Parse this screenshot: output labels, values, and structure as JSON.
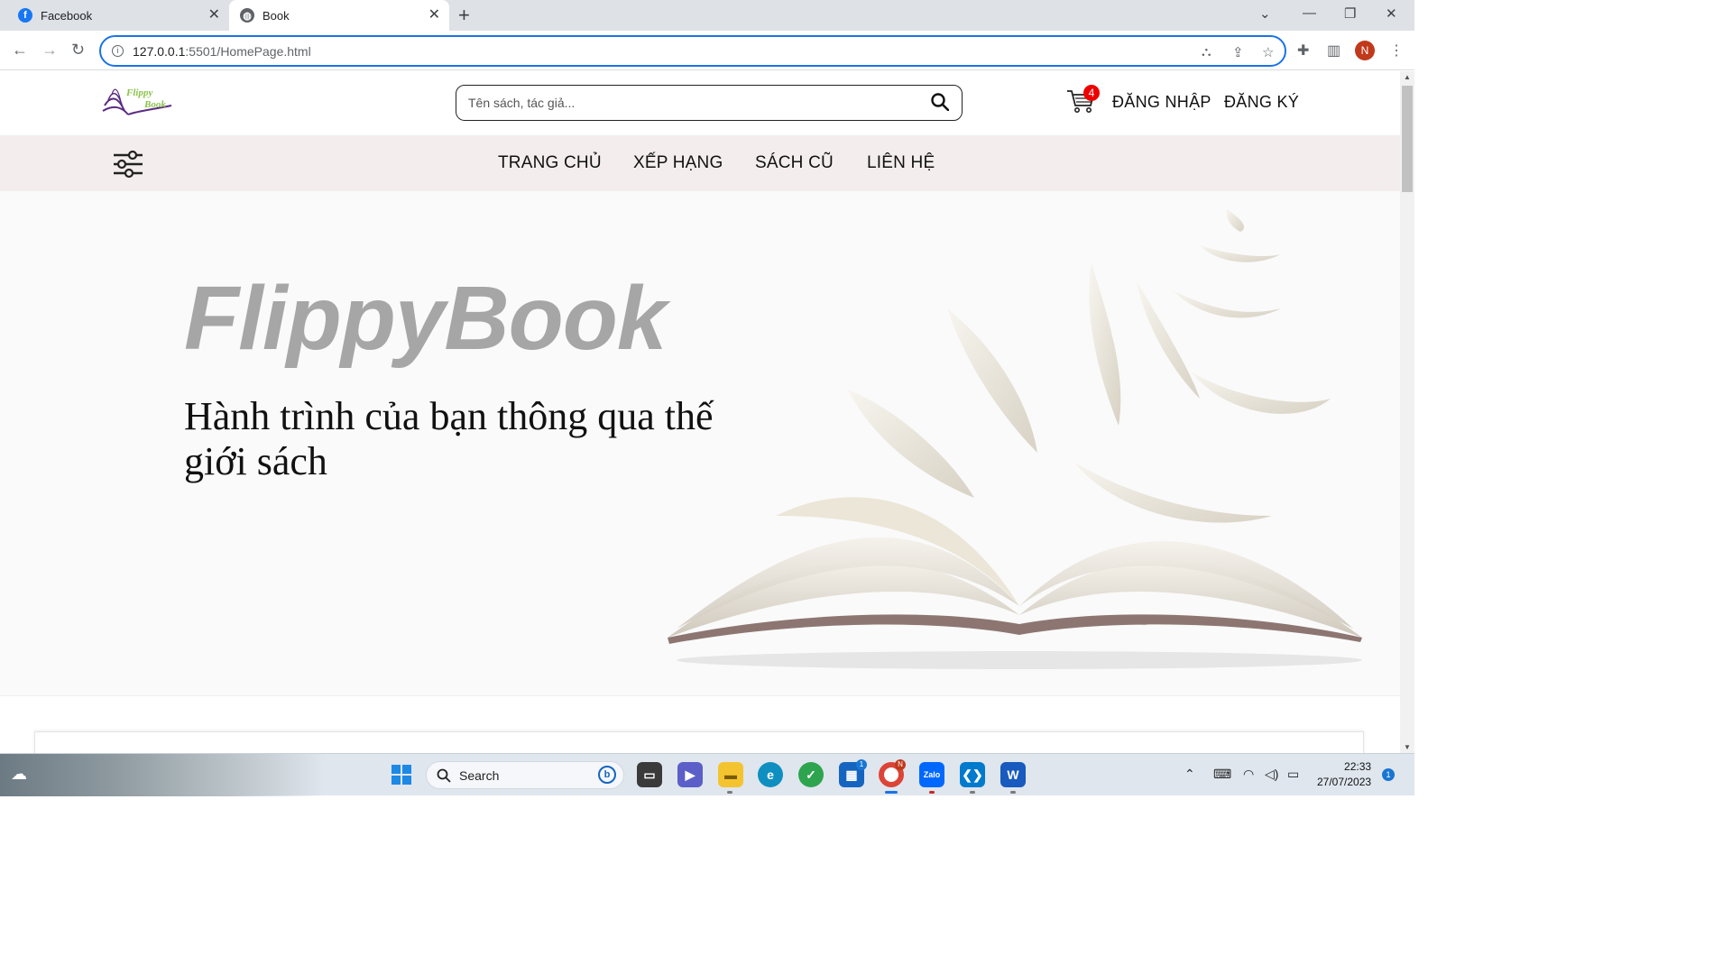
{
  "browser": {
    "tabs": [
      {
        "title": "Facebook",
        "active": false,
        "favicon": "facebook-icon"
      },
      {
        "title": "Book",
        "active": true,
        "favicon": "globe-icon"
      }
    ],
    "url_host": "127.0.0.1",
    "url_path": ":5501/HomePage.html",
    "profile_initial": "N"
  },
  "site": {
    "logo_line1": "Flippy",
    "logo_line2": "Book",
    "search_placeholder": "Tên sách, tác giả...",
    "cart_count": "4",
    "login_label": "ĐĂNG NHẬP",
    "register_label": "ĐĂNG KÝ",
    "menu": [
      "TRANG CHỦ",
      "XẾP HẠNG",
      "SÁCH CŨ",
      "LIÊN HỆ"
    ]
  },
  "hero": {
    "title": "FlippyBook",
    "subtitle": "Hành trình của bạn thông qua thế giới sách"
  },
  "taskbar": {
    "search_label": "Search",
    "time": "22:33",
    "date": "27/07/2023",
    "notifications": "1",
    "chrome_badge": "N",
    "store_badge": "1"
  },
  "colors": {
    "accent": "#1a73e8",
    "hero_title": "#a6a6a6",
    "menubar_bg": "#f3eded",
    "cart_badge": "#e00000"
  }
}
